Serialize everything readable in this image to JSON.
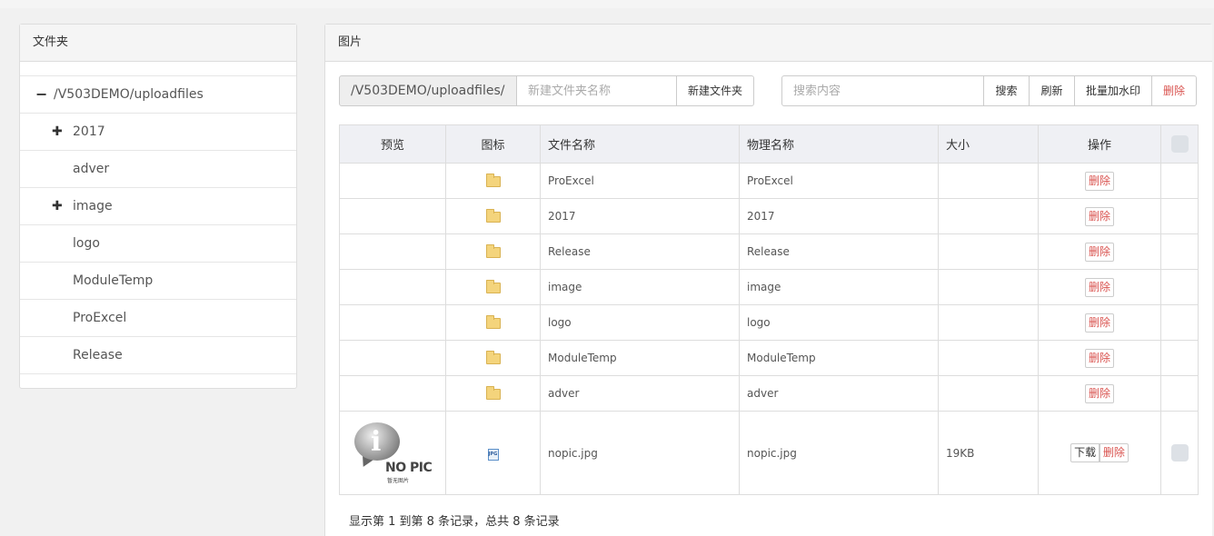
{
  "left_panel": {
    "title": "文件夹",
    "tree": [
      {
        "toggle": "−",
        "label": "/V503DEMO/uploadfiles"
      },
      {
        "toggle": "✚",
        "label": "2017"
      },
      {
        "toggle": "",
        "label": "adver"
      },
      {
        "toggle": "✚",
        "label": "image"
      },
      {
        "toggle": "",
        "label": "logo"
      },
      {
        "toggle": "",
        "label": "ModuleTemp"
      },
      {
        "toggle": "",
        "label": "ProExcel"
      },
      {
        "toggle": "",
        "label": "Release"
      }
    ]
  },
  "right_panel": {
    "title": "图片",
    "toolbar": {
      "path": "/V503DEMO/uploadfiles/",
      "new_folder_placeholder": "新建文件夹名称",
      "new_folder_button": "新建文件夹",
      "search_placeholder": "搜索内容",
      "search_button": "搜索",
      "refresh_button": "刷新",
      "watermark_button": "批量加水印",
      "delete_button": "删除"
    },
    "table": {
      "headers": [
        "预览",
        "图标",
        "文件名称",
        "物理名称",
        "大小",
        "操作"
      ],
      "rows": [
        {
          "icon": "folder-icon",
          "name": "ProExcel",
          "physical": "ProExcel",
          "size": "",
          "delete": "删除"
        },
        {
          "icon": "folder-icon",
          "name": "2017",
          "physical": "2017",
          "size": "",
          "delete": "删除"
        },
        {
          "icon": "folder-icon",
          "name": "Release",
          "physical": "Release",
          "size": "",
          "delete": "删除"
        },
        {
          "icon": "folder-icon",
          "name": "image",
          "physical": "image",
          "size": "",
          "delete": "删除"
        },
        {
          "icon": "folder-icon",
          "name": "logo",
          "physical": "logo",
          "size": "",
          "delete": "删除"
        },
        {
          "icon": "folder-icon",
          "name": "ModuleTemp",
          "physical": "ModuleTemp",
          "size": "",
          "delete": "删除"
        },
        {
          "icon": "folder-icon",
          "name": "adver",
          "physical": "adver",
          "size": "",
          "delete": "删除"
        }
      ],
      "file_row": {
        "preview_text": "NO PIC",
        "preview_subtext": "暂无图片",
        "icon": "jpg-file-icon",
        "icon_text": "JPG",
        "name": "nopic.jpg",
        "physical": "nopic.jpg",
        "size": "19KB",
        "download": "下载",
        "delete": "删除"
      }
    },
    "footer": "显示第 1 到第 8 条记录，总共 8 条记录"
  }
}
